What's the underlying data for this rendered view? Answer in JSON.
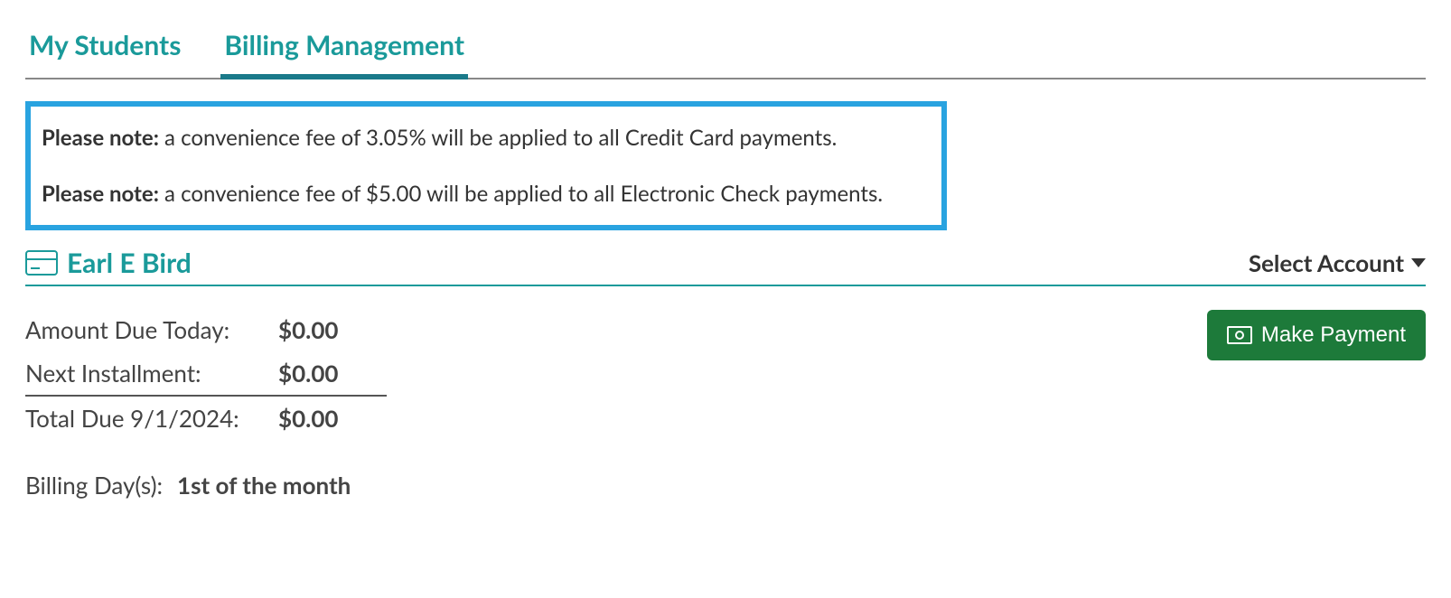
{
  "tabs": [
    {
      "label": "My Students",
      "active": false
    },
    {
      "label": "Billing Management",
      "active": true
    }
  ],
  "notices": [
    {
      "prefix": "Please note:",
      "text": " a convenience fee of 3.05% will be applied to all Credit Card payments."
    },
    {
      "prefix": "Please note:",
      "text": " a convenience fee of $5.00 will be applied to all Electronic Check payments."
    }
  ],
  "account": {
    "name": "Earl E Bird",
    "select_label": "Select Account"
  },
  "summary": {
    "amount_due_today": {
      "label": "Amount Due Today:",
      "value": "$0.00"
    },
    "next_installment": {
      "label": "Next Installment:",
      "value": "$0.00"
    },
    "total_due": {
      "label": "Total Due 9/1/2024:",
      "value": "$0.00"
    }
  },
  "billing_days": {
    "label": "Billing Day(s):",
    "value": "1st of the month"
  },
  "buttons": {
    "make_payment": "Make Payment"
  }
}
